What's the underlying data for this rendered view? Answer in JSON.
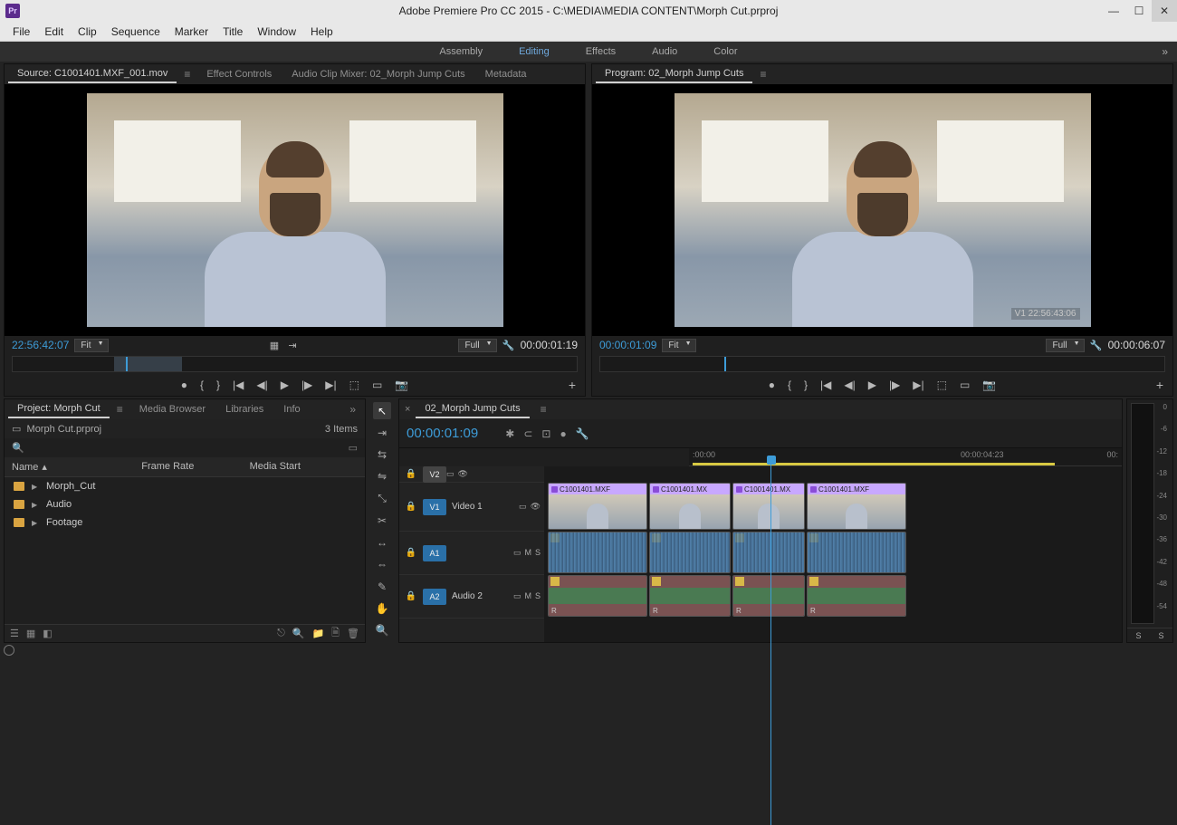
{
  "titlebar": {
    "logo": "Pr",
    "title": "Adobe Premiere Pro CC 2015 - C:\\MEDIA\\MEDIA CONTENT\\Morph Cut.prproj"
  },
  "menu": [
    "File",
    "Edit",
    "Clip",
    "Sequence",
    "Marker",
    "Title",
    "Window",
    "Help"
  ],
  "workspaces": [
    "Assembly",
    "Editing",
    "Effects",
    "Audio",
    "Color"
  ],
  "workspace_active": "Editing",
  "source": {
    "tabs": [
      "Source: C1001401.MXF_001.mov",
      "Effect Controls",
      "Audio Clip Mixer: 02_Morph Jump Cuts",
      "Metadata"
    ],
    "tc_in": "22:56:42:07",
    "zoom": "Fit",
    "quality": "Full",
    "tc_dur": "00:00:01:19"
  },
  "program": {
    "title": "Program: 02_Morph Jump Cuts",
    "overlay_tc": "V1 22:56:43:06",
    "tc_in": "00:00:01:09",
    "zoom": "Fit",
    "quality": "Full",
    "tc_dur": "00:00:06:07"
  },
  "project": {
    "tabs": [
      "Project: Morph Cut",
      "Media Browser",
      "Libraries",
      "Info"
    ],
    "file": "Morph Cut.prproj",
    "item_count": "3 Items",
    "columns": [
      "Name",
      "Frame Rate",
      "Media Start"
    ],
    "bins": [
      "Morph_Cut",
      "Audio",
      "Footage"
    ]
  },
  "timeline": {
    "sequence": "02_Morph Jump Cuts",
    "tc": "00:00:01:09",
    "ruler": {
      "start": ":00:00",
      "mid": "00:00:04:23",
      "end": "00:"
    },
    "tracks": {
      "v2": "V2",
      "v1": {
        "tag": "V1",
        "label": "Video 1"
      },
      "a1": {
        "tag": "A1",
        "m": "M",
        "s": "S"
      },
      "a2": {
        "tag": "A2",
        "label": "Audio 2",
        "m": "M",
        "s": "S"
      }
    },
    "clips": [
      "C1001401.MXF",
      "C1001401.MX",
      "C1001401.MX",
      "C1001401.MXF"
    ],
    "clip_widths": [
      110,
      90,
      80,
      110
    ]
  },
  "meters": {
    "scale": [
      "0",
      "-6",
      "-12",
      "-18",
      "-24",
      "-30",
      "-36",
      "-42",
      "-48",
      "-54",
      ""
    ],
    "footer": [
      "S",
      "S"
    ]
  }
}
